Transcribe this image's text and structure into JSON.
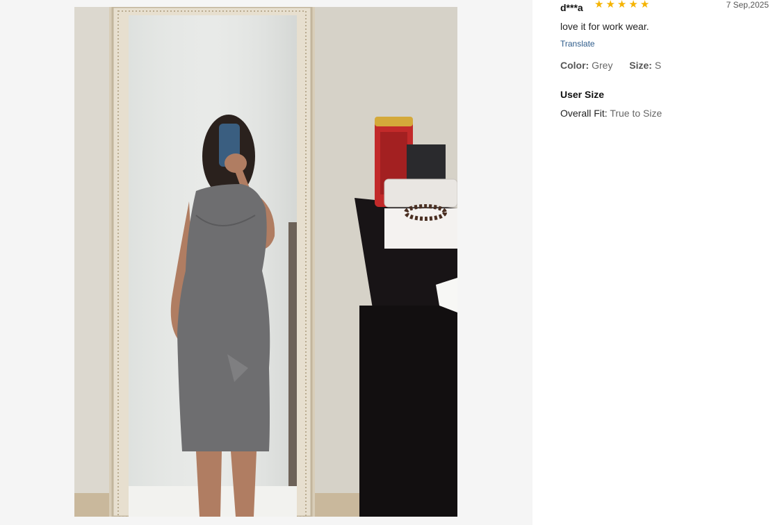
{
  "review": {
    "username": "d***a",
    "rating": 5,
    "date": "7 Sep,2025",
    "text": "love it for work wear.",
    "translate_label": "Translate",
    "attributes": {
      "color_label": "Color:",
      "color_value": "Grey",
      "size_label": "Size:",
      "size_value": "S"
    },
    "user_size": {
      "title": "User Size",
      "fit_label": "Overall Fit:",
      "fit_value": "True to Size"
    }
  },
  "colors": {
    "star": "#f5b301",
    "link": "#2d5b8a",
    "gallery_bg": "#f5f5f5"
  },
  "icons": {
    "star": "star-icon"
  }
}
